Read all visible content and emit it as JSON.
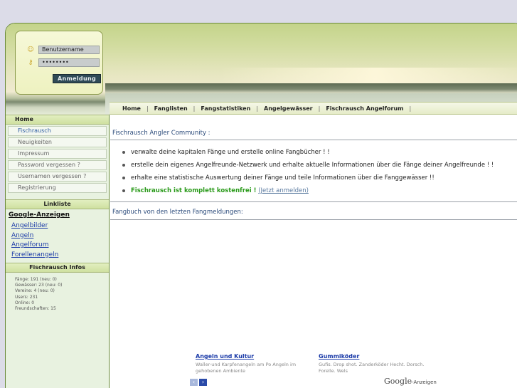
{
  "login": {
    "username_value": "Benutzername",
    "password_value": "••••••••",
    "submit_label": "Anmeldung"
  },
  "nav": {
    "items": [
      "Home",
      "Fanglisten",
      "Fangstatistiken",
      "Angelgewässer",
      "Fischrausch Angelforum"
    ],
    "separator": "|"
  },
  "sidebar": {
    "home_header": "Home",
    "menu": [
      "Fischrausch",
      "Neuigkeiten",
      "Impressum",
      "Password vergessen ?",
      "Usernamen vergessen ?",
      "Registrierung"
    ],
    "linkliste_header": "Linkliste",
    "ads_title": "Google-Anzeigen",
    "ad_links": [
      "Angelbilder",
      "Angeln",
      "Angelforum",
      "Forellenangeln"
    ],
    "infos_header": "Fischrausch Infos",
    "infos": [
      "Fänge: 191 (neu: 0)",
      "Gewässer: 23 (neu: 0)",
      "Vereine: 4 (neu: 0)",
      "Users: 231",
      "Online: 0",
      "Freundschaften: 15"
    ]
  },
  "main": {
    "community_title": "Fischrausch Angler Community :",
    "bullets": [
      "verwalte deine kapitalen Fänge und erstelle online Fangbücher ! !",
      "erstelle dein eigenes Angelfreunde-Netzwerk und erhalte aktuelle Informationen über die Fänge deiner Angelfreunde ! !",
      "erhalte eine statistische Auswertung deiner Fänge und teile Informationen über die Fanggewässer !!"
    ],
    "free_text": "Fischrausch ist komplett kostenfrei !",
    "free_link": "(Jetzt anmelden)",
    "fangbuch_title": "Fangbuch von den letzten Fangmeldungen:"
  },
  "ads": [
    {
      "title": "Angeln und Kultur",
      "desc": "Waller-und Karpfenangeln am Po Angeln im gehobenen Ambiente"
    },
    {
      "title": "Gummiköder",
      "desc": "Gufis. Drop shot. Zanderköder Hecht. Dorsch. Forelle. Wels"
    }
  ],
  "ads_nav": {
    "prev": "‹",
    "next": "›"
  },
  "google_brand": {
    "logo": "Google",
    "suffix": "-Anzeigen"
  },
  "colors": {
    "accent_green": "#2a9a1a",
    "link_blue": "#1a3aa8",
    "frame_green": "#6a8a3a"
  }
}
